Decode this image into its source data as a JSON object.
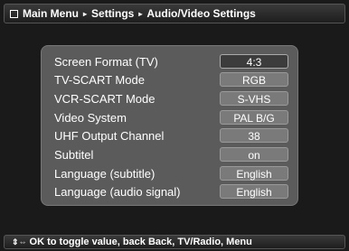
{
  "header": {
    "breadcrumb": [
      "Main Menu",
      "Settings",
      "Audio/Video Settings"
    ],
    "separator": "▸"
  },
  "settings": [
    {
      "label": "Screen Format (TV)",
      "value": "4:3",
      "selected": true
    },
    {
      "label": "TV-SCART Mode",
      "value": "RGB"
    },
    {
      "label": "VCR-SCART Mode",
      "value": "S-VHS"
    },
    {
      "label": "Video System",
      "value": "PAL B/G"
    },
    {
      "label": "UHF Output Channel",
      "value": "38"
    },
    {
      "label": "Subtitel",
      "value": "on"
    },
    {
      "label": "Language (subtitle)",
      "value": "English"
    },
    {
      "label": "Language (audio signal)",
      "value": "English"
    }
  ],
  "footer": {
    "nav_icon": "⇕⇔",
    "text": "OK to toggle value, back Back, TV/Radio, Menu"
  }
}
